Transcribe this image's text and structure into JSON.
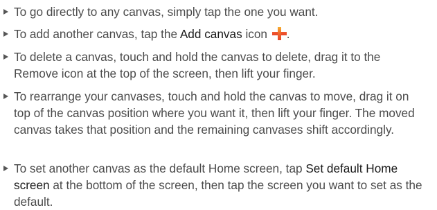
{
  "items": [
    {
      "text": "To go directly to any canvas, simply tap the one you want."
    },
    {
      "pre": "To add another canvas, tap the ",
      "bold": "Add canvas",
      "post": " icon",
      "end": ".",
      "icon": "add-canvas-icon",
      "icon_colors": [
        "#f7b12f",
        "#e8452a"
      ]
    },
    {
      "text": "To delete a canvas, touch and hold the canvas to delete, drag it to the Remove icon at the top of the screen, then lift your finger."
    },
    {
      "text": "To rearrange your canvases, touch and hold the canvas to move, drag it on top of the canvas position where you want it, then lift your finger. The moved canvas takes that position and the remaining canvases shift accordingly."
    },
    {
      "pre": "To set another canvas as the default Home screen, tap ",
      "bold": "Set default Home screen",
      "post": " at the bottom of the screen, then tap the screen you want to set as the default."
    }
  ]
}
